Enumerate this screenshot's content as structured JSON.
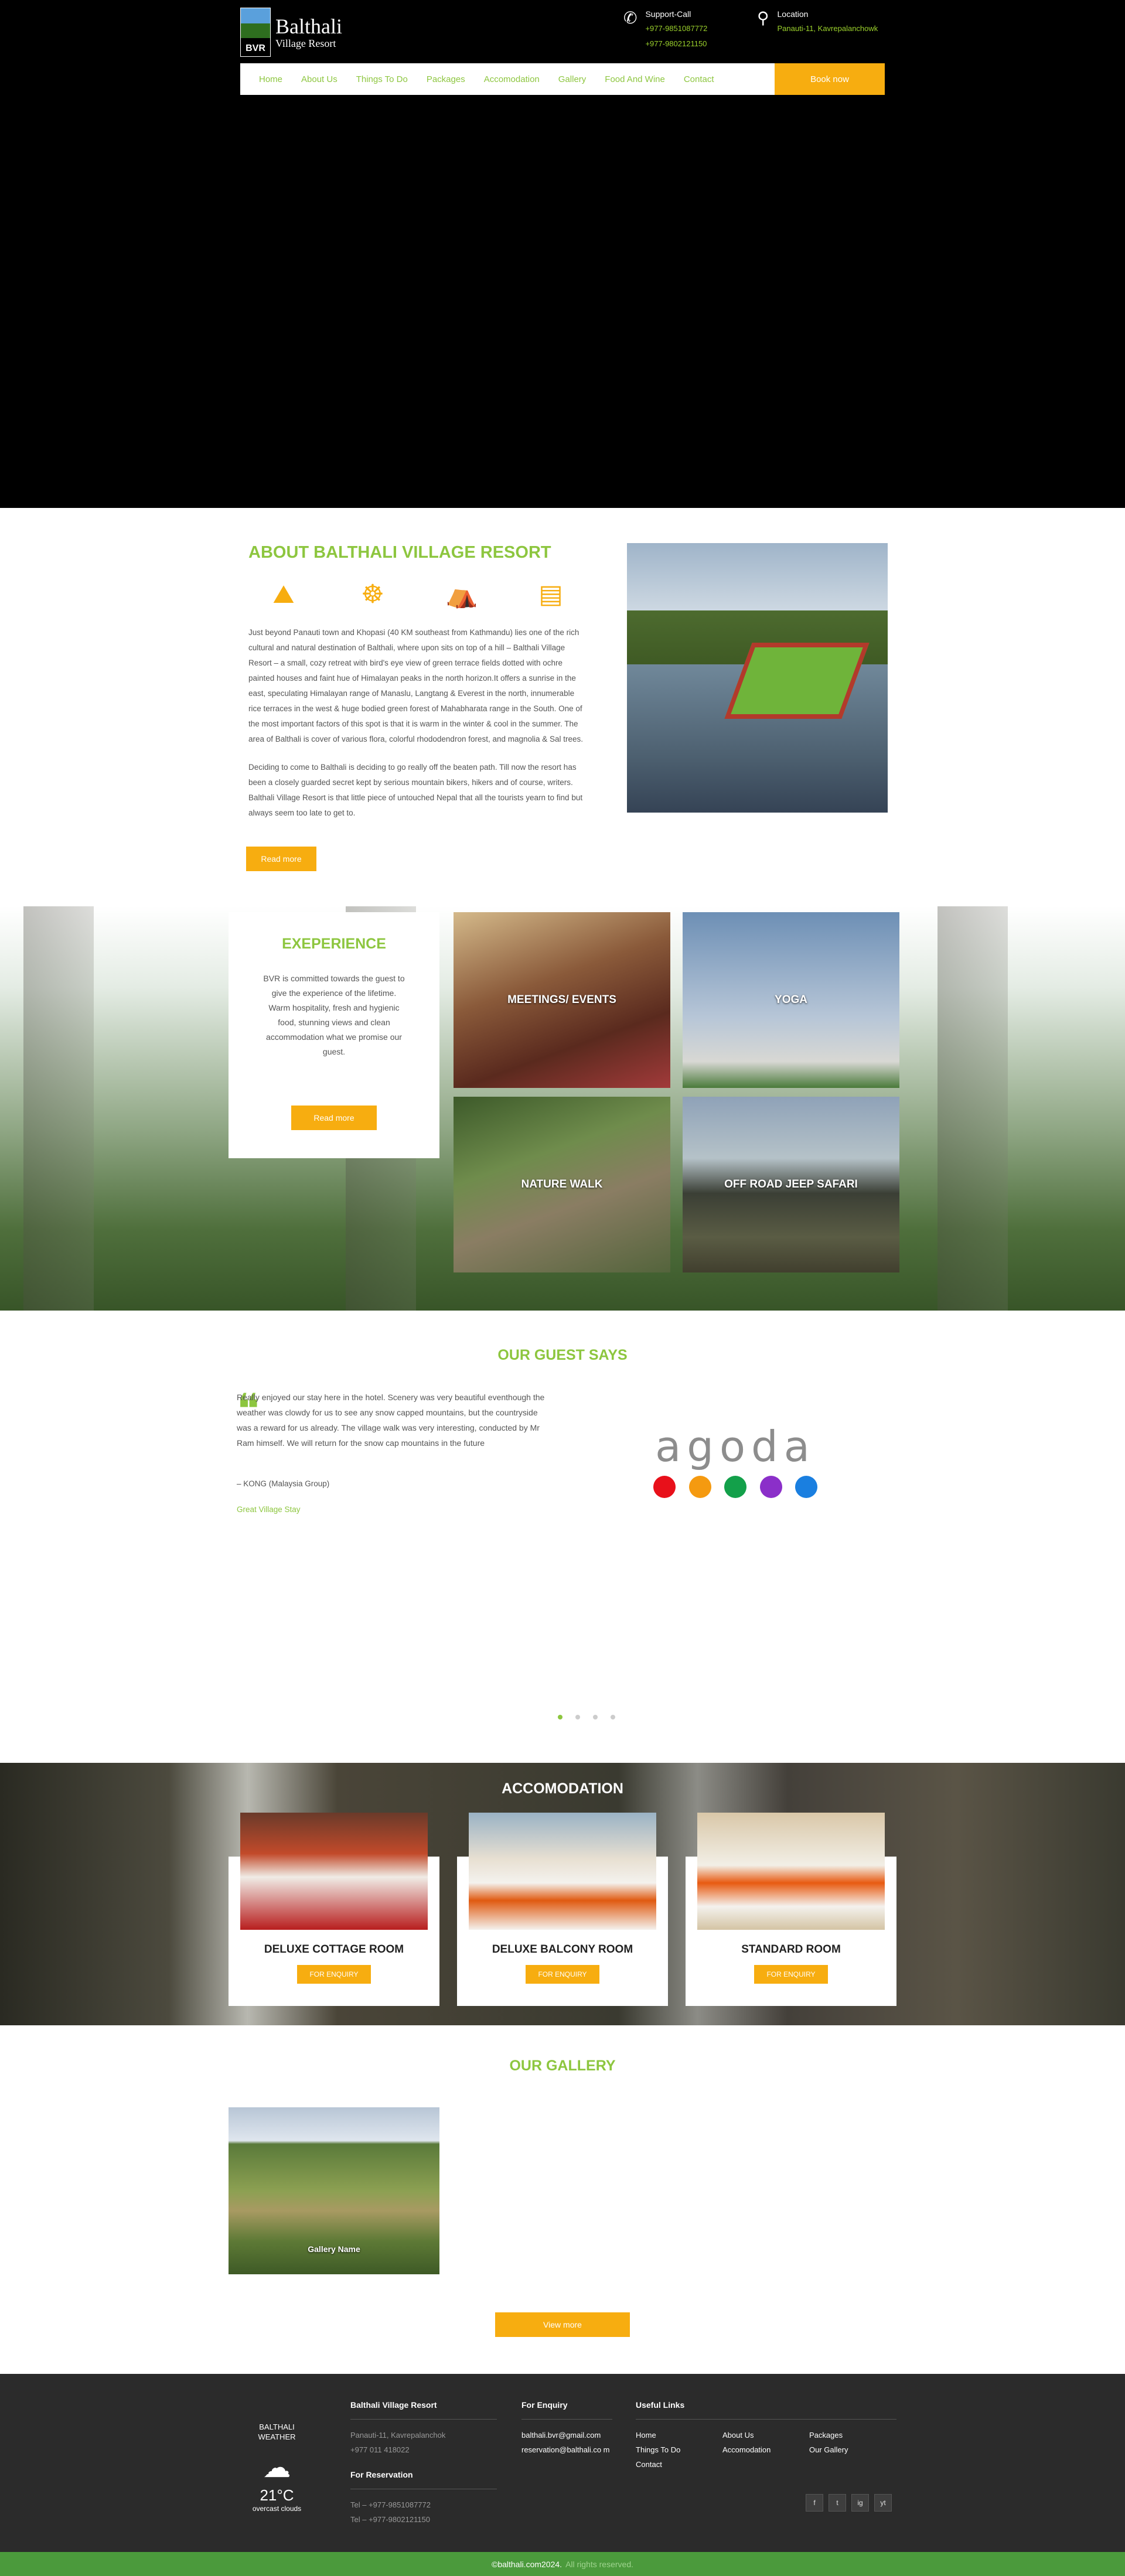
{
  "brand": {
    "abbr": "BVR",
    "name_line1": "Balthali",
    "name_line2": "Village Resort"
  },
  "header": {
    "support_label": "Support-Call",
    "support_phone1": "+977-9851087772",
    "support_phone2": "+977-9802121150",
    "location_label": "Location",
    "location_value": "Panauti-11, Kavrepalanchowk"
  },
  "nav": {
    "items": [
      "Home",
      "About Us",
      "Things To Do",
      "Packages",
      "Accomodation",
      "Gallery",
      "Food And Wine",
      "Contact"
    ],
    "book_label": "Book now"
  },
  "about": {
    "title": "ABOUT BALTHALI VILLAGE RESORT",
    "paragraph1": "Just beyond Panauti town and Khopasi (40 KM southeast from Kathmandu) lies one of the rich cultural and natural destination of Balthali, where upon sits on top of a hill – Balthali Village Resort – a small, cozy retreat with bird's eye view of green terrace fields dotted with ochre painted houses and faint hue of Himalayan peaks in the north horizon.It offers a sunrise in the east, speculating Himalayan range of Manaslu, Langtang & Everest in the north, innumerable rice terraces in the west & huge bodied green forest of Mahabharata range in the South. One of the most important factors of this spot is that it is warm in the winter & cool in the summer. The area of Balthali is cover of various flora, colorful rhododendron forest, and magnolia & Sal trees.",
    "paragraph2": "Deciding to come to Balthali is deciding to go really off the beaten path. Till now the resort has been a closely guarded secret kept by serious mountain bikers, hikers and of course, writers. Balthali Village Resort is that little piece of untouched Nepal that all the tourists yearn to find but always seem too late to get to.",
    "read_more": "Read more",
    "icons": [
      "mountain-icon",
      "meditation-icon",
      "hiking-icon",
      "bed-icon"
    ]
  },
  "experience": {
    "title": "EXEPERIENCE",
    "text": "BVR is committed towards the guest to give the experience of the lifetime. Warm hospitality, fresh and hygienic food, stunning views and clean accommodation what we promise our guest.",
    "read_more": "Read more",
    "tiles": [
      "MEETINGS/ EVENTS",
      "YOGA",
      "NATURE WALK",
      "OFF ROAD JEEP SAFARI"
    ]
  },
  "guests": {
    "title": "OUR GUEST SAYS",
    "quote": "Really enjoyed our stay here in the hotel. Scenery was very beautiful eventhough the weather was clowdy for us to see any snow capped mountains, but the countryside was a reward for us already. The village walk was very interesting, conducted by Mr Ram himself. We will return for the snow cap mountains in the future",
    "author": "– KONG (Malaysia Group)",
    "source": "Great Village Stay",
    "partner": "agoda",
    "partner_dot_colors": [
      "#e8101a",
      "#f59a10",
      "#13a04a",
      "#8b2fc9",
      "#1a7fe0"
    ]
  },
  "accomodation": {
    "title": "ACCOMODATION",
    "rooms": [
      {
        "name": "DELUXE COTTAGE ROOM",
        "button": "FOR ENQUIRY"
      },
      {
        "name": "DELUXE BALCONY ROOM",
        "button": "FOR ENQUIRY"
      },
      {
        "name": "STANDARD ROOM",
        "button": "FOR ENQUIRY"
      }
    ]
  },
  "gallery": {
    "title": "OUR GALLERY",
    "item_name": "Gallery Name",
    "view_more": "View more"
  },
  "footer": {
    "weather": {
      "line1": "BALTHALI",
      "line2": "WEATHER",
      "temp": "21°C",
      "desc": "overcast clouds"
    },
    "resort": {
      "title": "Balthali Village Resort",
      "address": "Panauti-11, Kavrepalanchok",
      "phone": "+977 011 418022"
    },
    "reservation": {
      "title": "For Reservation",
      "tel1": "Tel – +977-9851087772",
      "tel2": "Tel – +977-9802121150"
    },
    "enquiry": {
      "title": "For Enquiry",
      "email1": "balthali.bvr@gmail.com",
      "email2": "reservation@balthali.co m"
    },
    "useful": {
      "title": "Useful Links",
      "links": [
        "Home",
        "About Us",
        "Packages",
        "Things To Do",
        "Accomodation",
        "Our Gallery",
        "Contact"
      ]
    },
    "social": [
      "f",
      "t",
      "ig",
      "yt"
    ],
    "copyright": "©balthali.com2024.",
    "rights": "All rights reserved."
  },
  "colors": {
    "accent_green": "#8dc63f",
    "accent_orange": "#f7ad10",
    "footer_bar": "#4b9a3c"
  }
}
